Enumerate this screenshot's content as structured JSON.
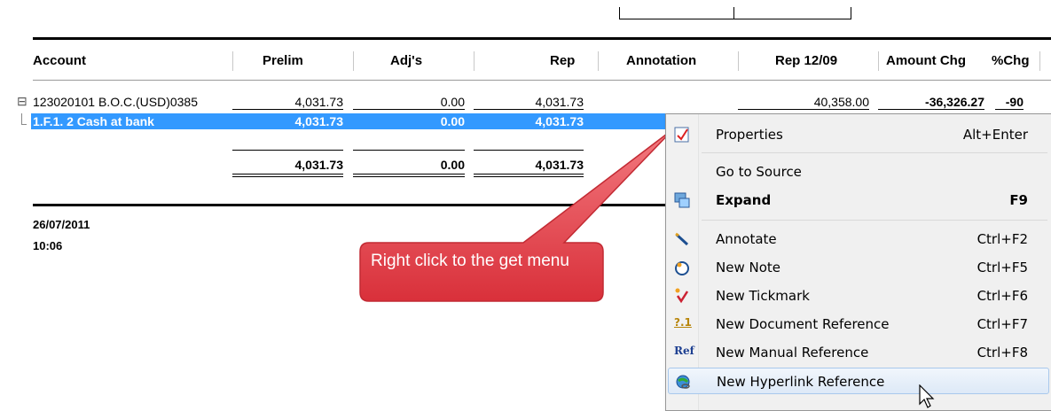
{
  "table": {
    "columns": [
      "Account",
      "Prelim",
      "Adj's",
      "Rep",
      "Annotation",
      "Rep 12/09",
      "Amount Chg",
      "%Chg"
    ],
    "rows": [
      {
        "account": "123020101 B.O.C.(USD)0385",
        "prelim": "4,031.73",
        "adj": "0.00",
        "rep": "4,031.73",
        "rep_prev": "40,358.00",
        "amount_chg": "-36,326.27",
        "pct_chg": "-90"
      },
      {
        "account": "1.F.1. 2  Cash at bank",
        "prelim": "4,031.73",
        "adj": "0.00",
        "rep": "4,031.73"
      }
    ],
    "totals": {
      "prelim": "4,031.73",
      "adj": "0.00",
      "rep": "4,031.73"
    },
    "tree_toggle": "⊟"
  },
  "footer": {
    "date": "26/07/2011",
    "time": "10:06"
  },
  "callout": {
    "text": "Right click to the get menu",
    "color": "#e8434b"
  },
  "context_menu": {
    "items": [
      {
        "label": "Properties",
        "shortcut": "Alt+Enter",
        "icon": "properties-icon"
      },
      {
        "label": "Go to Source",
        "shortcut": "",
        "icon": ""
      },
      {
        "label": "Expand",
        "shortcut": "F9",
        "icon": "expand-icon"
      },
      {
        "label": "Annotate",
        "shortcut": "Ctrl+F2",
        "icon": "annotate-icon"
      },
      {
        "label": "New Note",
        "shortcut": "Ctrl+F5",
        "icon": "note-icon"
      },
      {
        "label": "New Tickmark",
        "shortcut": "Ctrl+F6",
        "icon": "tickmark-icon"
      },
      {
        "label": "New Document Reference",
        "shortcut": "Ctrl+F7",
        "icon": "document-reference-icon"
      },
      {
        "label": "New Manual Reference",
        "shortcut": "Ctrl+F8",
        "icon": "manual-reference-icon"
      },
      {
        "label": "New Hyperlink Reference",
        "shortcut": "",
        "icon": "hyperlink-reference-icon"
      }
    ],
    "icon_texts": {
      "doc_ref": "?.1",
      "manual_ref": "Ref"
    }
  },
  "colors": {
    "selection": "#3399ff",
    "header_rule": "#000000",
    "menu_bg": "#f0f0f0"
  }
}
